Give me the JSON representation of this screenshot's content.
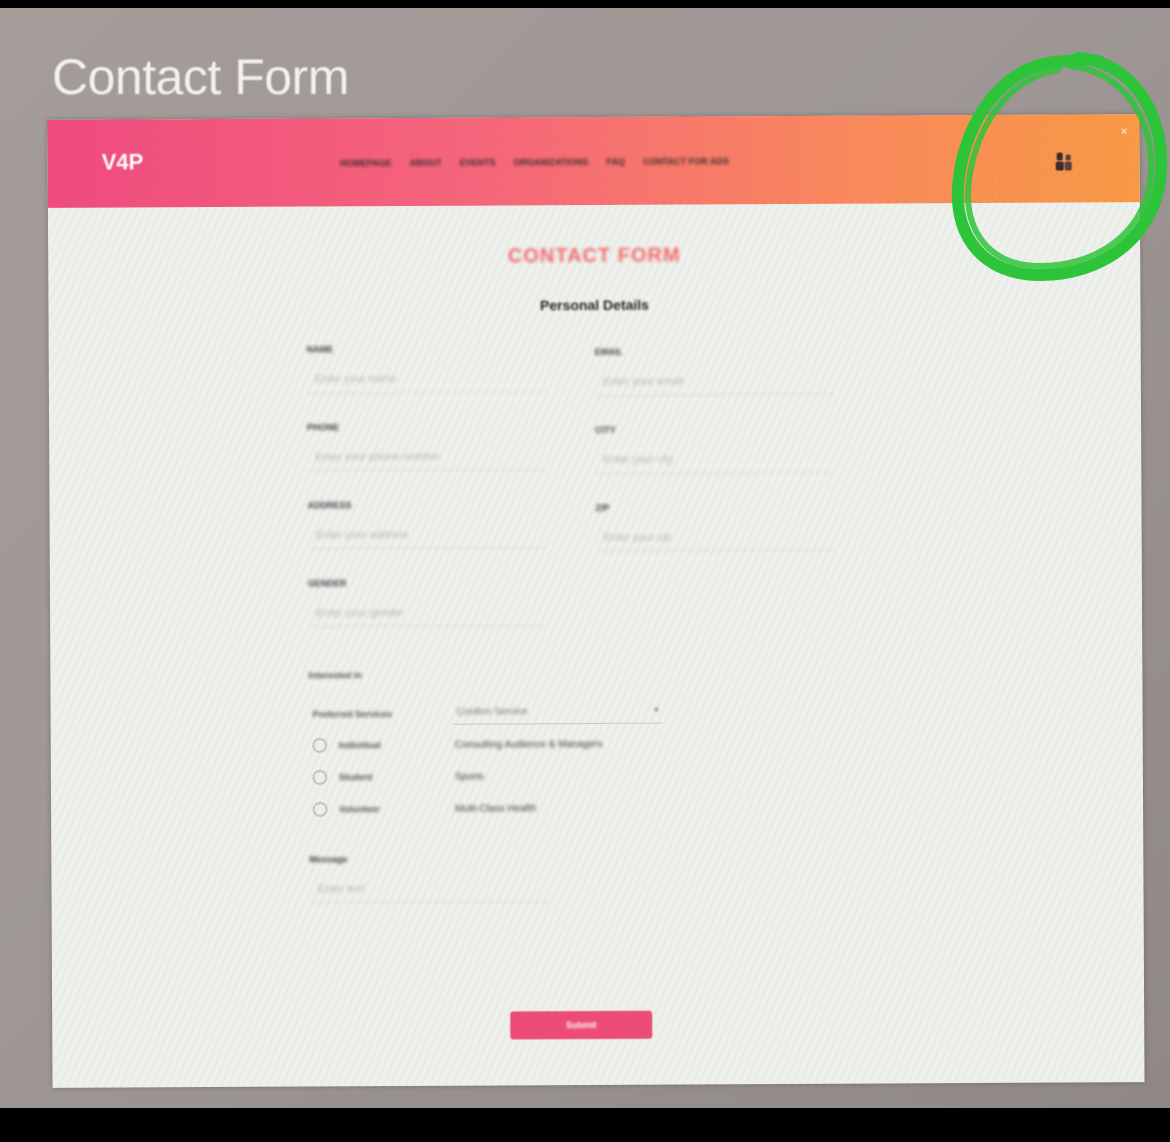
{
  "photo": {
    "heading": "Contact Form"
  },
  "navbar": {
    "logo": "V4P",
    "links": [
      "HOMEPAGE",
      "ABOUT",
      "EVENTS",
      "ORGANIZATIONS",
      "FAQ",
      "CONTACT FOR ADS"
    ],
    "close_glyph": "×",
    "user_icon": "user-icon"
  },
  "form": {
    "title": "CONTACT FORM",
    "section_title": "Personal Details",
    "fields": [
      {
        "label": "NAME",
        "placeholder": "Enter your name"
      },
      {
        "label": "EMAIL",
        "placeholder": "Enter your email"
      },
      {
        "label": "PHONE",
        "placeholder": "Enter your phone number"
      },
      {
        "label": "CITY",
        "placeholder": "Enter your city"
      },
      {
        "label": "ADDRESS",
        "placeholder": "Enter your address"
      },
      {
        "label": "ZIP",
        "placeholder": "Enter your zip"
      },
      {
        "label": "GENDER",
        "placeholder": "Enter your gender"
      }
    ],
    "group_label": "Interested in",
    "select_label": "Preferred Services",
    "select_value": "Confirm Service",
    "options": [
      {
        "label": "Individual",
        "value": "Consulting Audience & Managers"
      },
      {
        "label": "Student",
        "value": "Sports"
      },
      {
        "label": "Volunteer",
        "value": "Multi-Class Health"
      }
    ],
    "message_label": "Message",
    "message_placeholder": "Enter text",
    "submit_label": "Submit"
  },
  "annotation": {
    "color": "#2ec43a"
  }
}
